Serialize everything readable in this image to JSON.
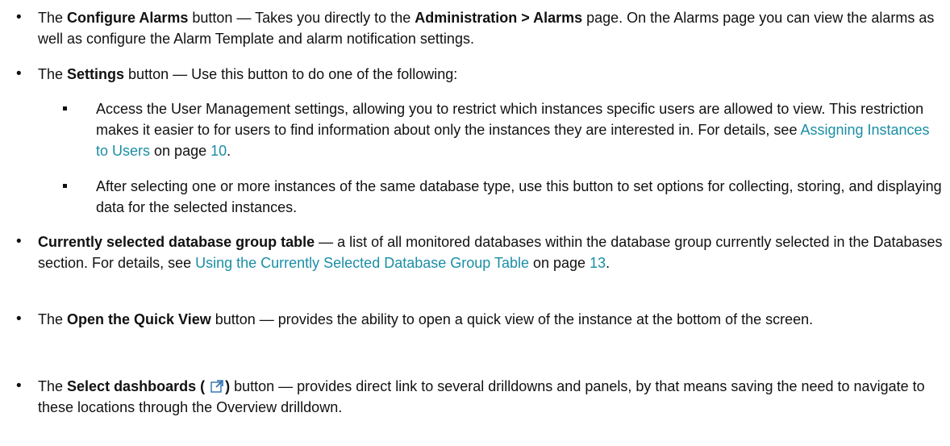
{
  "bullets": [
    {
      "symbol": "•",
      "pre": "The ",
      "b1": "Configure Alarms",
      "mid": " button — Takes you directly to the ",
      "b2": "Administration > Alarms",
      "post": " page. On the Alarms page you can view the alarms as well as configure the Alarm Template and alarm notification settings."
    },
    {
      "symbol": "•",
      "pre": "The ",
      "b1": "Settings",
      "post": " button — Use this button to do one of the following:"
    },
    {
      "symbol": "•",
      "b1": "Currently selected database group table",
      "mid": " — a list of all monitored databases within the database group currently selected in the Databases section. For details, see ",
      "link": "Using the Currently Selected Database Group Table",
      "on_page": " on page ",
      "page": "13",
      "end": "."
    },
    {
      "symbol": "•",
      "pre": "The ",
      "b1": "Open the Quick View",
      "post": " button — provides the ability to open a quick view of the instance at the bottom of the screen."
    },
    {
      "symbol": "•",
      "pre": "The ",
      "b1": "Select dashboards (",
      "icon": "external-link-icon",
      "b1_close": ")",
      "post": " button — provides direct link to several drilldowns and panels, by that means saving the need to navigate to these locations through the Overview drilldown."
    }
  ],
  "sub_bullets": [
    {
      "text": "Access the User Management settings, allowing you to restrict which instances specific users are allowed to view. This restriction makes it easier to for users to find information about only the instances they are interested in. For details, see ",
      "link": "Assigning Instances to Users",
      "on_page": " on page ",
      "page": "10",
      "end": "."
    },
    {
      "text": "After selecting one or more instances of the same database type, use this button to set options for collecting, storing, and displaying data for the selected instances."
    }
  ],
  "colors": {
    "link": "#1b8ea5",
    "text": "#111111",
    "icon": "#2a6fb0"
  }
}
